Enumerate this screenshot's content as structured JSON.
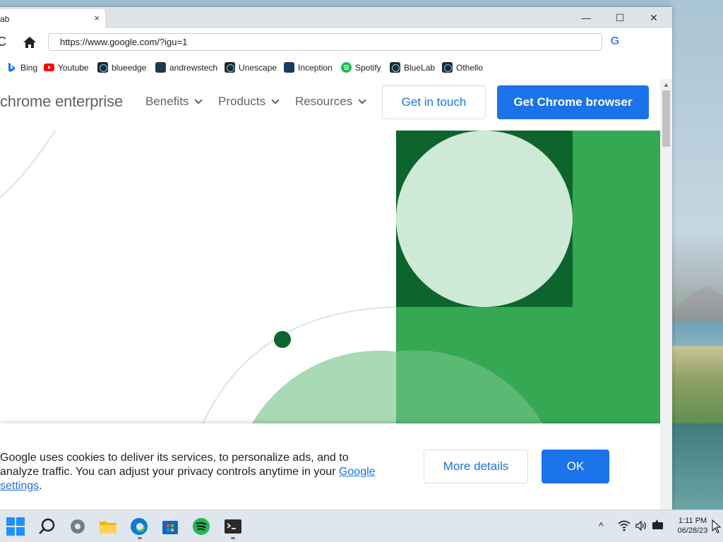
{
  "browser": {
    "tab_title": "ab",
    "tab_close": "×",
    "window_controls": {
      "minimize": "—",
      "maximize": "☐",
      "close": "✕"
    },
    "address_url": "https://www.google.com/?igu=1",
    "reload_glyph": "C",
    "search_engine_glyph": "G",
    "bookmarks": [
      {
        "label": "Bing",
        "icon": "bing-icon",
        "color": "#1a73e8"
      },
      {
        "label": "Youtube",
        "icon": "youtube-icon",
        "color": "#ff0000"
      },
      {
        "label": "blueedge",
        "icon": "react-icon",
        "color": "#61dafb"
      },
      {
        "label": "andrewstech",
        "icon": "andrewstech-icon",
        "color": "#1e3a4a"
      },
      {
        "label": "Unescape",
        "icon": "react-icon",
        "color": "#61dafb"
      },
      {
        "label": "Inception",
        "icon": "inception-icon",
        "color": "#1e90ff"
      },
      {
        "label": "Spotify",
        "icon": "spotify-icon",
        "color": "#1db954"
      },
      {
        "label": "BlueLab",
        "icon": "react-icon",
        "color": "#61dafb"
      },
      {
        "label": "Othello",
        "icon": "react-icon",
        "color": "#61dafb"
      }
    ]
  },
  "site": {
    "brand": "chrome enterprise",
    "nav": [
      {
        "label": "Benefits"
      },
      {
        "label": "Products"
      },
      {
        "label": "Resources"
      }
    ],
    "get_in_touch": "Get in touch",
    "get_chrome": "Get Chrome browser",
    "colors": {
      "accent": "#1a73e8",
      "green": "#34a853",
      "dark_green": "#0d652d",
      "light_green": "#ceead6"
    }
  },
  "cookie_banner": {
    "text": "Google uses cookies to deliver its services, to personalize ads, and to analyze traffic. You can adjust your privacy controls anytime in your ",
    "link": "Google settings",
    "trailing": ".",
    "more_details": "More details",
    "ok": "OK"
  },
  "taskbar": {
    "apps": [
      "start-icon",
      "search-icon",
      "settings-icon",
      "file-explorer-icon",
      "edge-icon",
      "store-icon",
      "spotify-icon",
      "terminal-icon"
    ],
    "tray": {
      "chevron": "^",
      "wifi": "wifi-icon",
      "volume": "volume-icon",
      "battery": "battery-icon"
    },
    "time": "1:11 PM",
    "date": "06/28/23"
  }
}
